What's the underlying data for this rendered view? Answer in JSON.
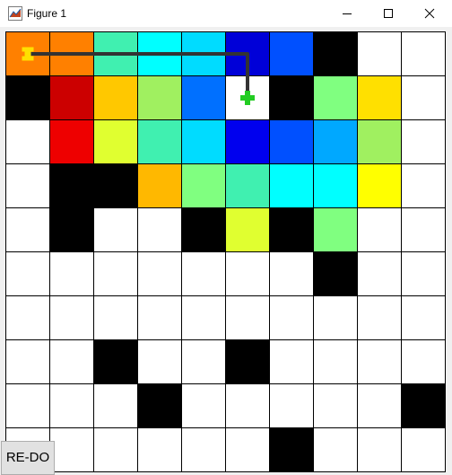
{
  "window": {
    "title": "Figure 1",
    "icon": "matlab-figure-icon",
    "controls": [
      "minimize-icon",
      "maximize-icon",
      "close-icon"
    ]
  },
  "board": {
    "rows": 10,
    "cols": 10,
    "cells": [
      [
        "#ff8000",
        "#ff8000",
        "#40f0b0",
        "#00ffff",
        "#00dcff",
        "#0000d8",
        "#0050ff",
        "#000000",
        "#ffffff",
        "#ffffff"
      ],
      [
        "#000000",
        "#cc0000",
        "#ffc800",
        "#a0f060",
        "#0070ff",
        "#ffffff",
        "#000000",
        "#80ff80",
        "#ffe000",
        "#ffffff"
      ],
      [
        "#ffffff",
        "#ee0000",
        "#e0ff30",
        "#40f0b0",
        "#00dcff",
        "#0000ee",
        "#0050ff",
        "#00a8ff",
        "#a0f060",
        "#ffffff"
      ],
      [
        "#ffffff",
        "#000000",
        "#000000",
        "#ffb800",
        "#80ff80",
        "#40f0b0",
        "#00ffff",
        "#00ffff",
        "#ffff00",
        "#ffffff"
      ],
      [
        "#ffffff",
        "#000000",
        "#ffffff",
        "#ffffff",
        "#000000",
        "#e0ff30",
        "#000000",
        "#80ff80",
        "#ffffff",
        "#ffffff"
      ],
      [
        "#ffffff",
        "#ffffff",
        "#ffffff",
        "#ffffff",
        "#ffffff",
        "#ffffff",
        "#ffffff",
        "#000000",
        "#ffffff",
        "#ffffff"
      ],
      [
        "#ffffff",
        "#ffffff",
        "#ffffff",
        "#ffffff",
        "#ffffff",
        "#ffffff",
        "#ffffff",
        "#ffffff",
        "#ffffff",
        "#ffffff"
      ],
      [
        "#ffffff",
        "#ffffff",
        "#000000",
        "#ffffff",
        "#ffffff",
        "#000000",
        "#ffffff",
        "#ffffff",
        "#ffffff",
        "#ffffff"
      ],
      [
        "#ffffff",
        "#ffffff",
        "#ffffff",
        "#000000",
        "#ffffff",
        "#ffffff",
        "#ffffff",
        "#ffffff",
        "#ffffff",
        "#000000"
      ],
      [
        "#ffffff",
        "#ffffff",
        "#ffffff",
        "#ffffff",
        "#ffffff",
        "#ffffff",
        "#000000",
        "#ffffff",
        "#ffffff",
        "#ffffff"
      ]
    ],
    "start": {
      "row": 0,
      "col": 0,
      "color": "#ffe000"
    },
    "goal": {
      "row": 1,
      "col": 5,
      "color": "#22cc22"
    },
    "path": [
      [
        0,
        0
      ],
      [
        0,
        5
      ],
      [
        1,
        5
      ]
    ],
    "path_color": "#333333"
  },
  "buttons": {
    "redo": "RE-DO"
  }
}
